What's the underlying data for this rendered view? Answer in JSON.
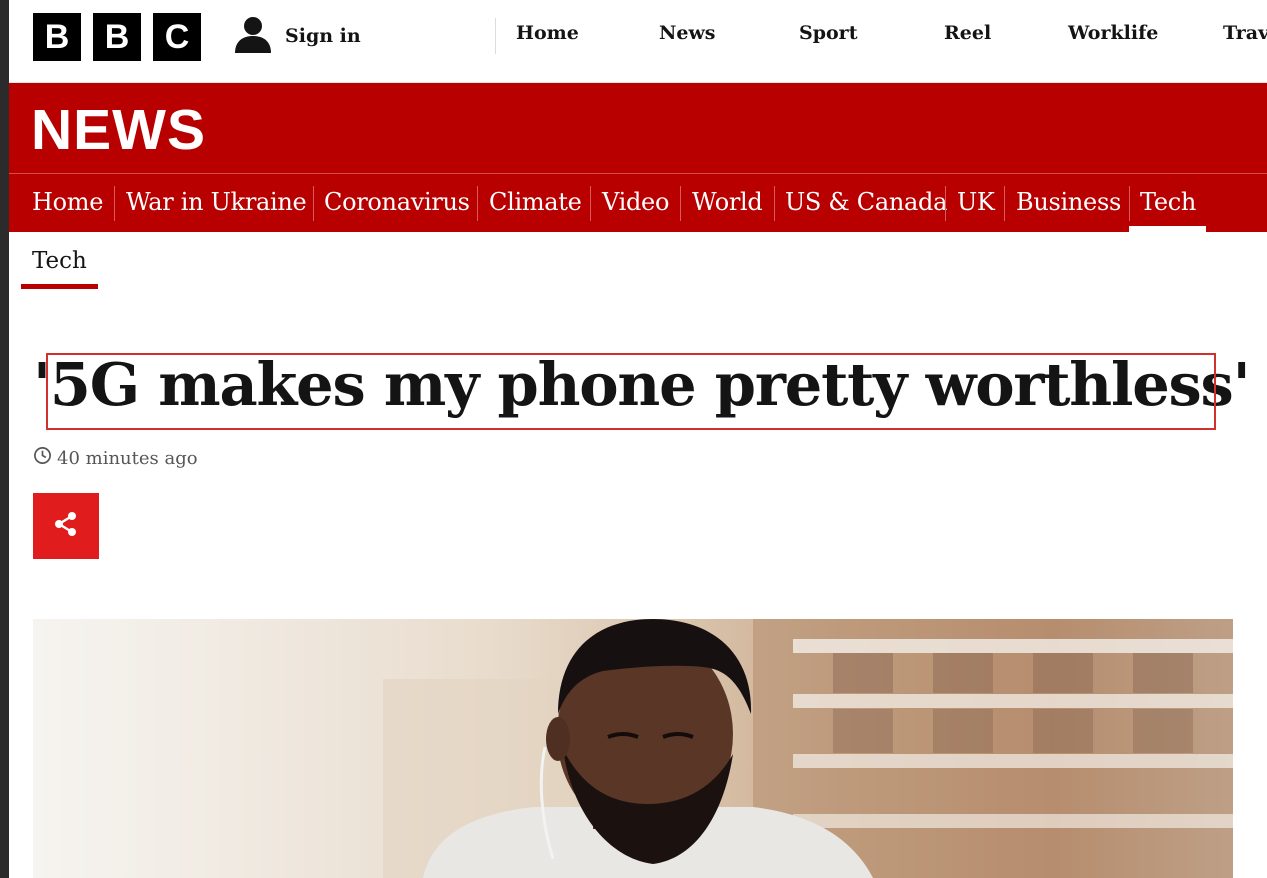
{
  "brand": {
    "letters": [
      "B",
      "B",
      "C"
    ]
  },
  "account": {
    "sign_in_label": "Sign in",
    "icon": "user-icon"
  },
  "top_nav": [
    "Home",
    "News",
    "Sport",
    "Reel",
    "Worklife",
    "Travel"
  ],
  "news_banner": {
    "title": "NEWS"
  },
  "section_nav": {
    "items": [
      "Home",
      "War in Ukraine",
      "Coronavirus",
      "Climate",
      "Video",
      "World",
      "US & Canada",
      "UK",
      "Business",
      "Tech"
    ],
    "active": "Tech"
  },
  "sub_nav": {
    "items": [
      "Tech"
    ],
    "active": "Tech"
  },
  "article": {
    "headline": "'5G makes my phone pretty worthless'",
    "timestamp": "40 minutes ago",
    "share_icon": "share-icon",
    "hero_image": "man-looking-at-phone-photo"
  },
  "colors": {
    "bbc_red": "#b80000",
    "share_red": "#e11c1c",
    "annotation_red": "#d0312d",
    "text": "#141414"
  }
}
